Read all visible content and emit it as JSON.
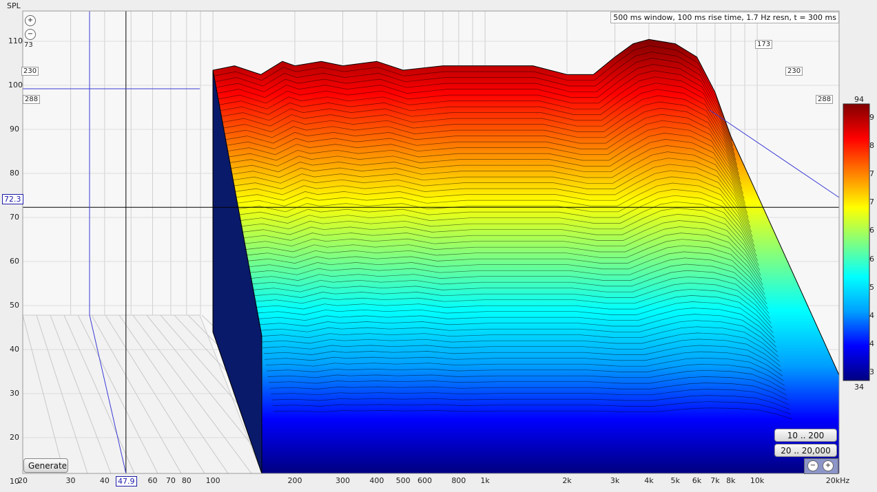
{
  "header": {
    "title": "500 ms window, 100 ms rise time,  1.7 Hz resn, t = 300 ms",
    "ylabel": "SPL",
    "x_unit": "kHz"
  },
  "cursor": {
    "x_value": "47.9",
    "y_value": "72.3"
  },
  "depth_labels": [
    "173",
    "230",
    "288"
  ],
  "small_left_label": "73",
  "colorbar": {
    "top": "94",
    "bottom": "34",
    "ticks": [
      "9",
      "8",
      "7",
      "7",
      "6",
      "6",
      "5",
      "4",
      "4",
      "3"
    ]
  },
  "buttons": {
    "generate": "Generate",
    "range_low": "10 .. 200",
    "range_full": "20 .. 20,000"
  },
  "chart_data": {
    "type": "waterfall",
    "title": "500 ms window, 100 ms rise time,  1.7 Hz resn, t = 300 ms",
    "ylabel": "SPL",
    "xlabel": "",
    "x_scale": "log",
    "xlim": [
      20,
      20000
    ],
    "ylim": [
      10,
      115
    ],
    "y_ticks": [
      "110",
      "100",
      "90",
      "80",
      "70",
      "60",
      "50",
      "40",
      "30",
      "20",
      "10"
    ],
    "x_ticks": [
      "20",
      "30",
      "40",
      "50",
      "60",
      "70",
      "80",
      "100",
      "200",
      "300",
      "400",
      "500",
      "600",
      "800",
      "1k",
      "2k",
      "3k",
      "4k",
      "5k",
      "6k",
      "7k",
      "8k",
      "10k",
      "20kHz"
    ],
    "time_ms": [
      0,
      300
    ],
    "colorscale": [
      "#000080",
      "#0000ff",
      "#00a0ff",
      "#00ffff",
      "#80ff80",
      "#ffff00",
      "#ff8000",
      "#ff0000",
      "#800000"
    ],
    "slice_front": {
      "freq": [
        100,
        120,
        150,
        180,
        200,
        250,
        300,
        400,
        500,
        700,
        1000,
        1500,
        2000,
        2500,
        3000,
        3500,
        4000,
        5000,
        6000,
        7000,
        8000
      ],
      "spl": [
        105,
        106,
        104,
        107,
        106,
        107,
        106,
        107,
        105,
        106,
        106,
        106,
        104,
        104,
        108,
        111,
        112,
        111,
        108,
        100,
        90
      ]
    },
    "decay_floor_spl": 44
  }
}
